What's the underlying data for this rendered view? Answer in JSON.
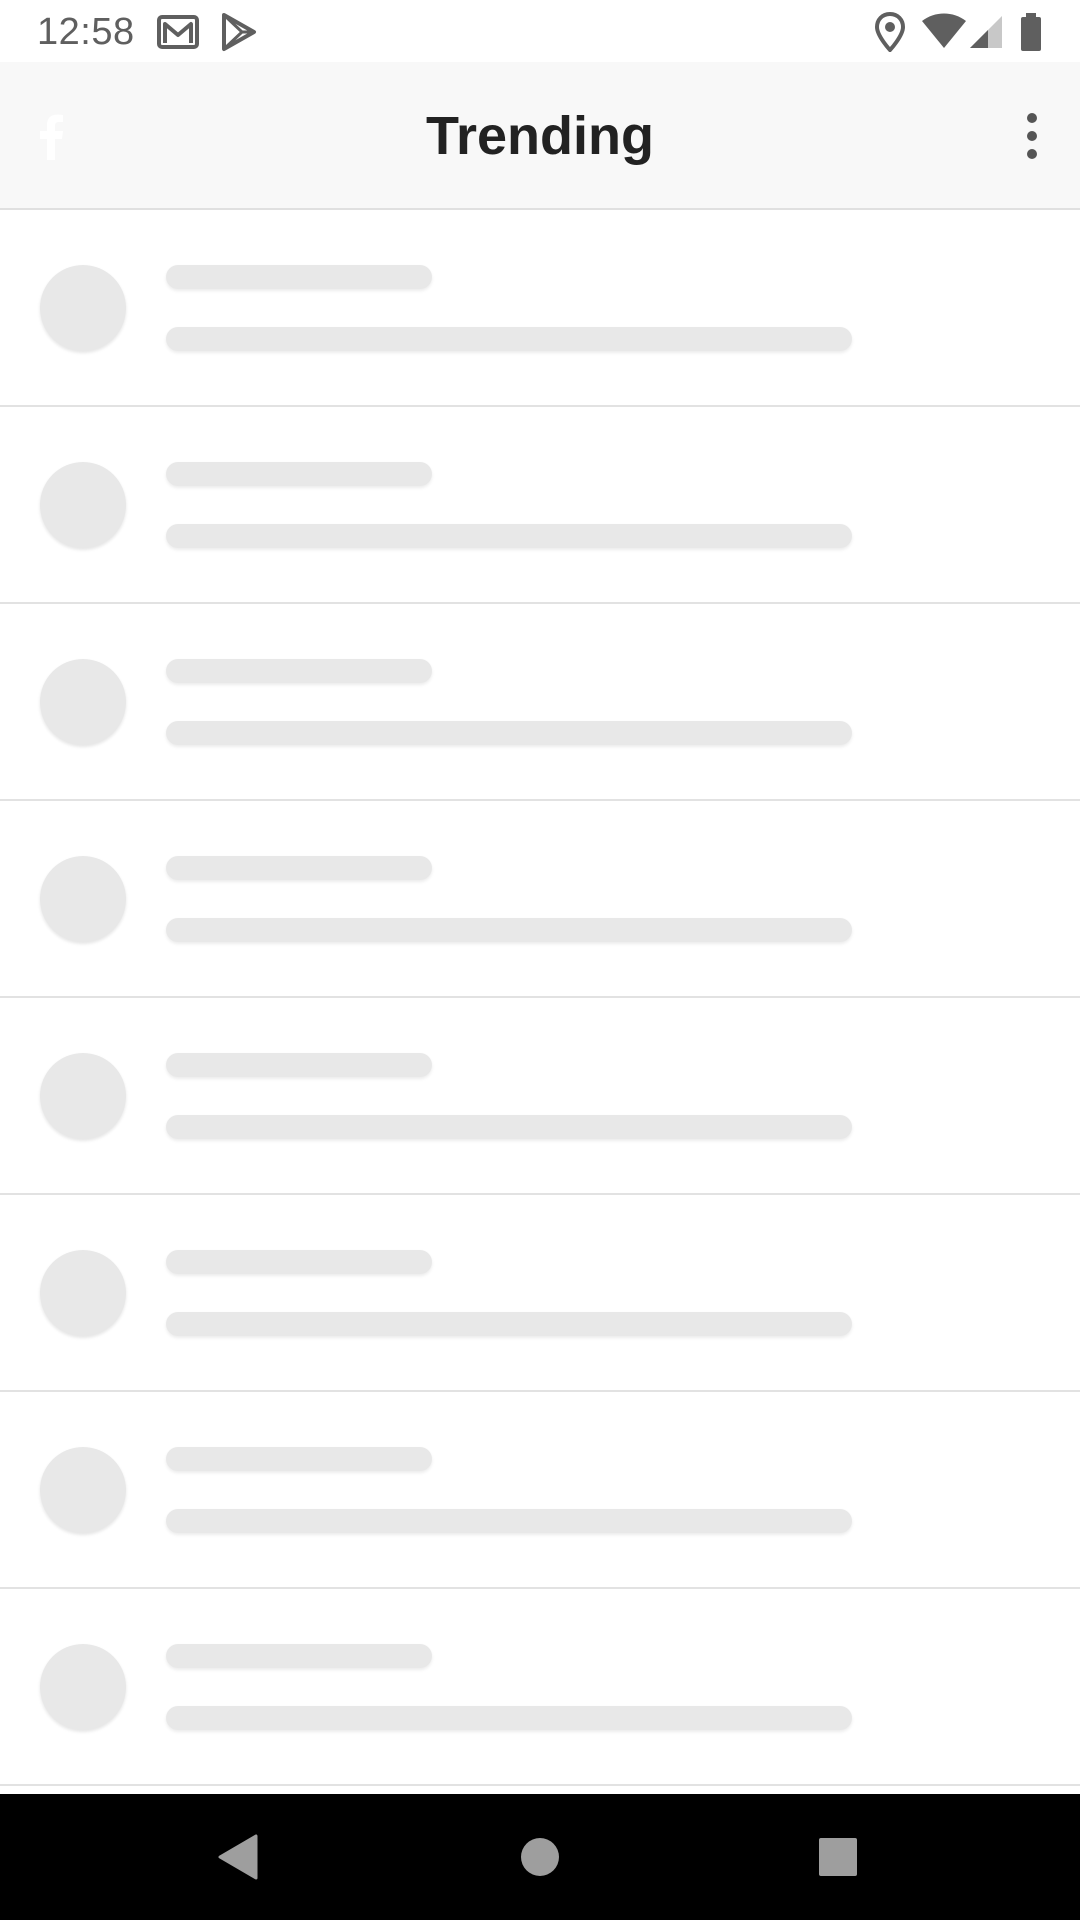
{
  "status_bar": {
    "time": "12:58",
    "left_icons": [
      "gmail-icon",
      "play-store-icon"
    ],
    "right_icons": [
      "location-icon",
      "wifi-icon",
      "cell-signal-icon",
      "battery-icon"
    ]
  },
  "app_bar": {
    "logo_icon": "facebook-icon",
    "title": "Trending",
    "menu_icon": "more-vert-icon"
  },
  "list": {
    "state": "loading",
    "placeholder_rows": 8
  },
  "nav_bar": {
    "buttons": [
      "back-icon",
      "home-icon",
      "recents-icon"
    ]
  },
  "colors": {
    "app_bar_bg": "#f8f8f8",
    "title": "#222222",
    "skeleton": "#e8e8e8",
    "divider": "#e2e2e2",
    "nav_bar_bg": "#000000",
    "status_icons": "#5f5f5f"
  }
}
